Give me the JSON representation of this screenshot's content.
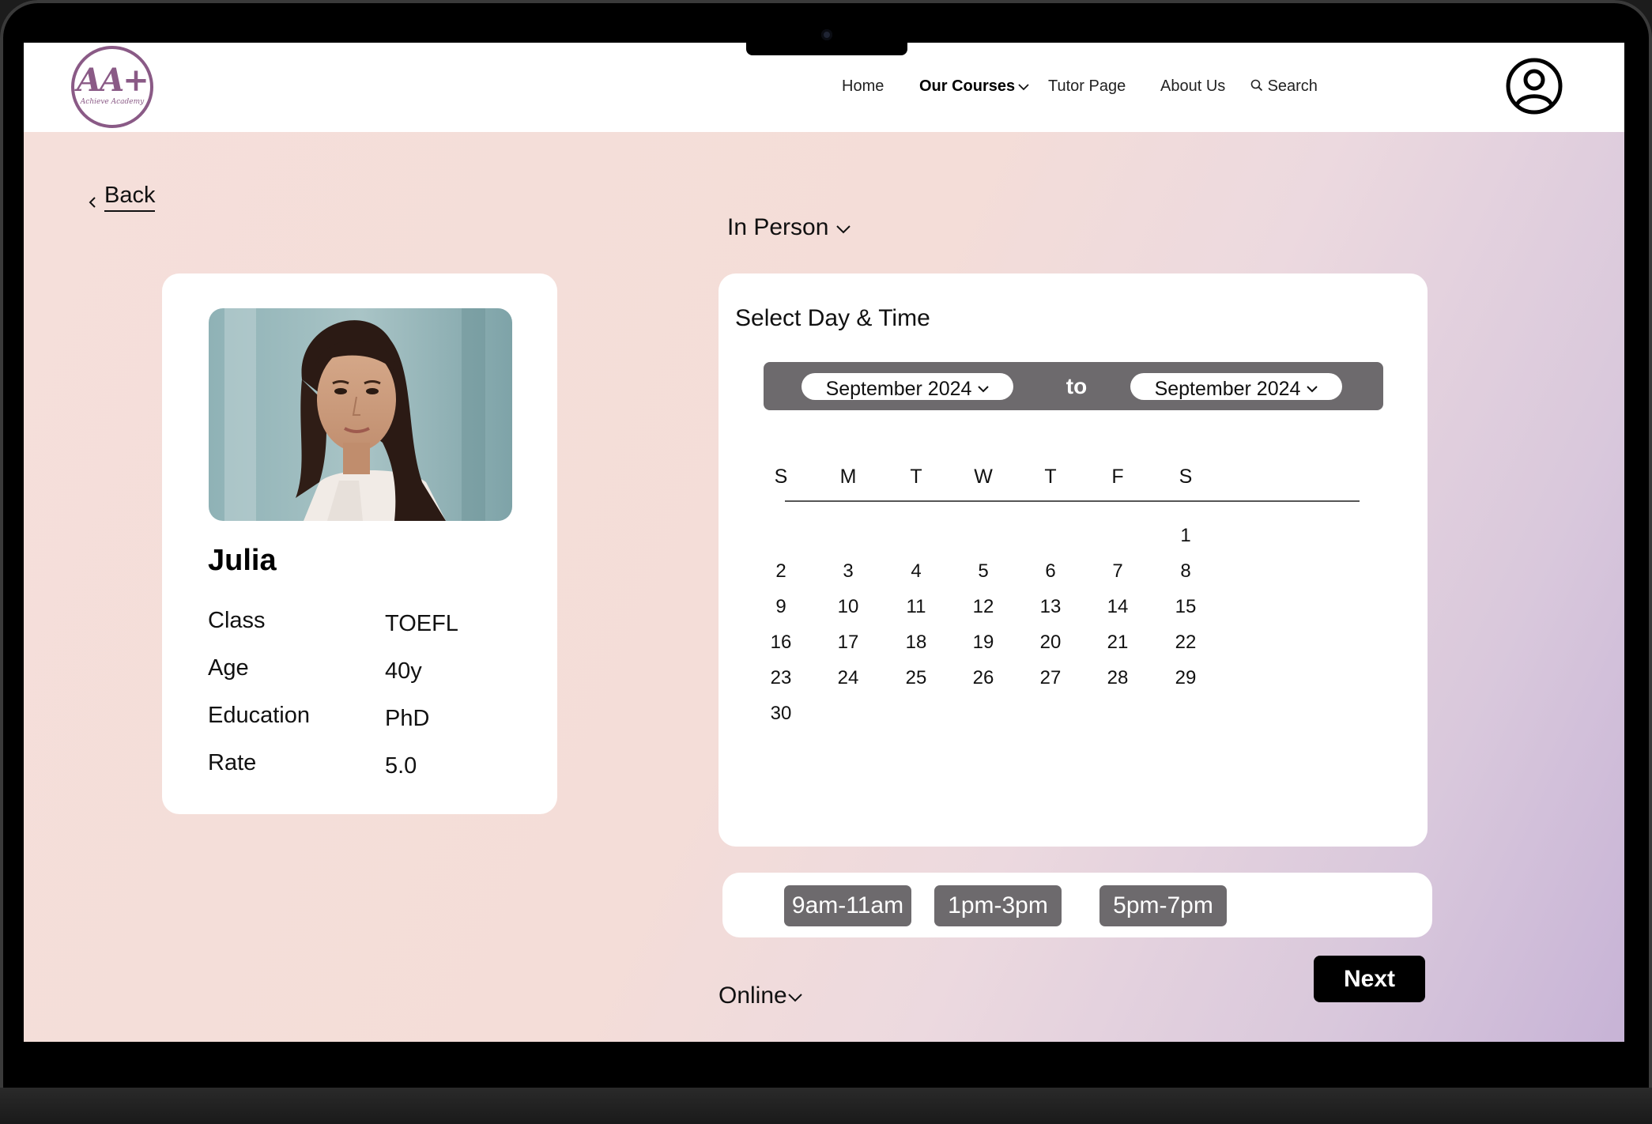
{
  "logo": {
    "main": "AA+",
    "sub": "Achieve Academy"
  },
  "nav": {
    "items": [
      {
        "label": "Home"
      },
      {
        "label": "Our Courses"
      },
      {
        "label": "Tutor Page"
      },
      {
        "label": "About Us"
      },
      {
        "label": "Search"
      }
    ]
  },
  "back_label": "Back",
  "mode": {
    "in_person": "In Person",
    "online": "Online"
  },
  "tutor": {
    "name": "Julia",
    "details": [
      {
        "key": "Class",
        "value": "TOEFL"
      },
      {
        "key": "Age",
        "value": "40y"
      },
      {
        "key": "Education",
        "value": "PhD"
      },
      {
        "key": "Rate",
        "value": "5.0"
      }
    ]
  },
  "calendar": {
    "title": "Select Day & Time",
    "from_month": "September 2024",
    "to_label": "to",
    "to_month": "September 2024",
    "weekdays": [
      "S",
      "M",
      "T",
      "W",
      "T",
      "F",
      "S"
    ],
    "days": [
      "1",
      "2",
      "3",
      "4",
      "5",
      "6",
      "7",
      "8",
      "9",
      "10",
      "11",
      "12",
      "13",
      "14",
      "15",
      "16",
      "17",
      "18",
      "19",
      "20",
      "21",
      "22",
      "23",
      "24",
      "25",
      "26",
      "27",
      "28",
      "29",
      "30"
    ]
  },
  "time_slots": [
    "9am-11am",
    "1pm-3pm",
    "5pm-7pm"
  ],
  "next_label": "Next",
  "colors": {
    "accent_purple": "#8a5a86",
    "pill_gray": "#6d6a6d",
    "button_black": "#000000"
  }
}
